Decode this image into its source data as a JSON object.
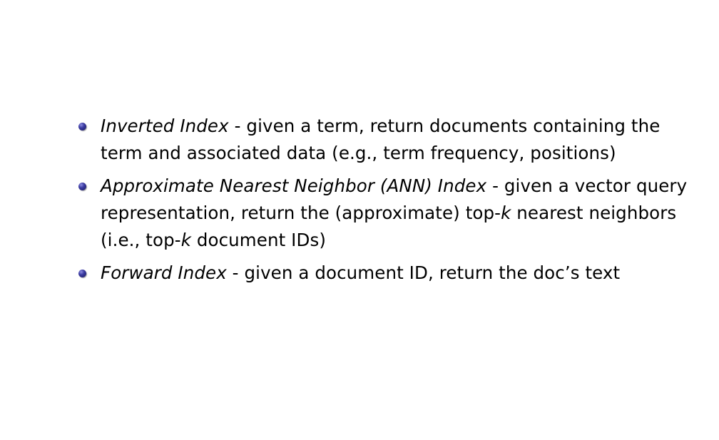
{
  "items": [
    {
      "term": "Inverted Index",
      "text": " - given a term, return documents containing the term and associated data (e.g., term frequency, positions)"
    },
    {
      "term": "Approximate Nearest Neighbor (ANN) Index",
      "text_a": " - given a vector query representation, return the (approximate) top-",
      "k1": "k",
      "text_b": " nearest neighbors (i.e., top-",
      "k2": "k",
      "text_c": " document IDs)"
    },
    {
      "term": "Forward Index",
      "text": " - given a document ID, return the doc’s text"
    }
  ],
  "colors": {
    "bullet": "#2a2a80",
    "text": "#000000",
    "background": "#ffffff"
  },
  "icons": {
    "bullet": "bullet-ball-icon"
  }
}
